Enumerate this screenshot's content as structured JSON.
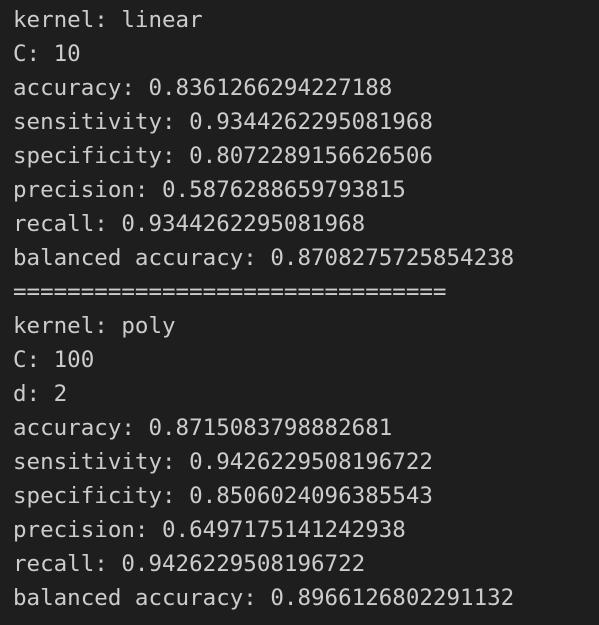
{
  "output_lines": [
    "kernel: linear",
    "C: 10",
    "accuracy: 0.8361266294227188",
    "sensitivity: 0.9344262295081968",
    "specificity: 0.8072289156626506",
    "precision: 0.5876288659793815",
    "recall: 0.9344262295081968",
    "balanced accuracy: 0.8708275725854238",
    "================================",
    "kernel: poly",
    "C: 100",
    "d: 2",
    "accuracy: 0.8715083798882681",
    "sensitivity: 0.9426229508196722",
    "specificity: 0.8506024096385543",
    "precision: 0.6497175141242938",
    "recall: 0.9426229508196722",
    "balanced accuracy: 0.8966126802291132"
  ]
}
